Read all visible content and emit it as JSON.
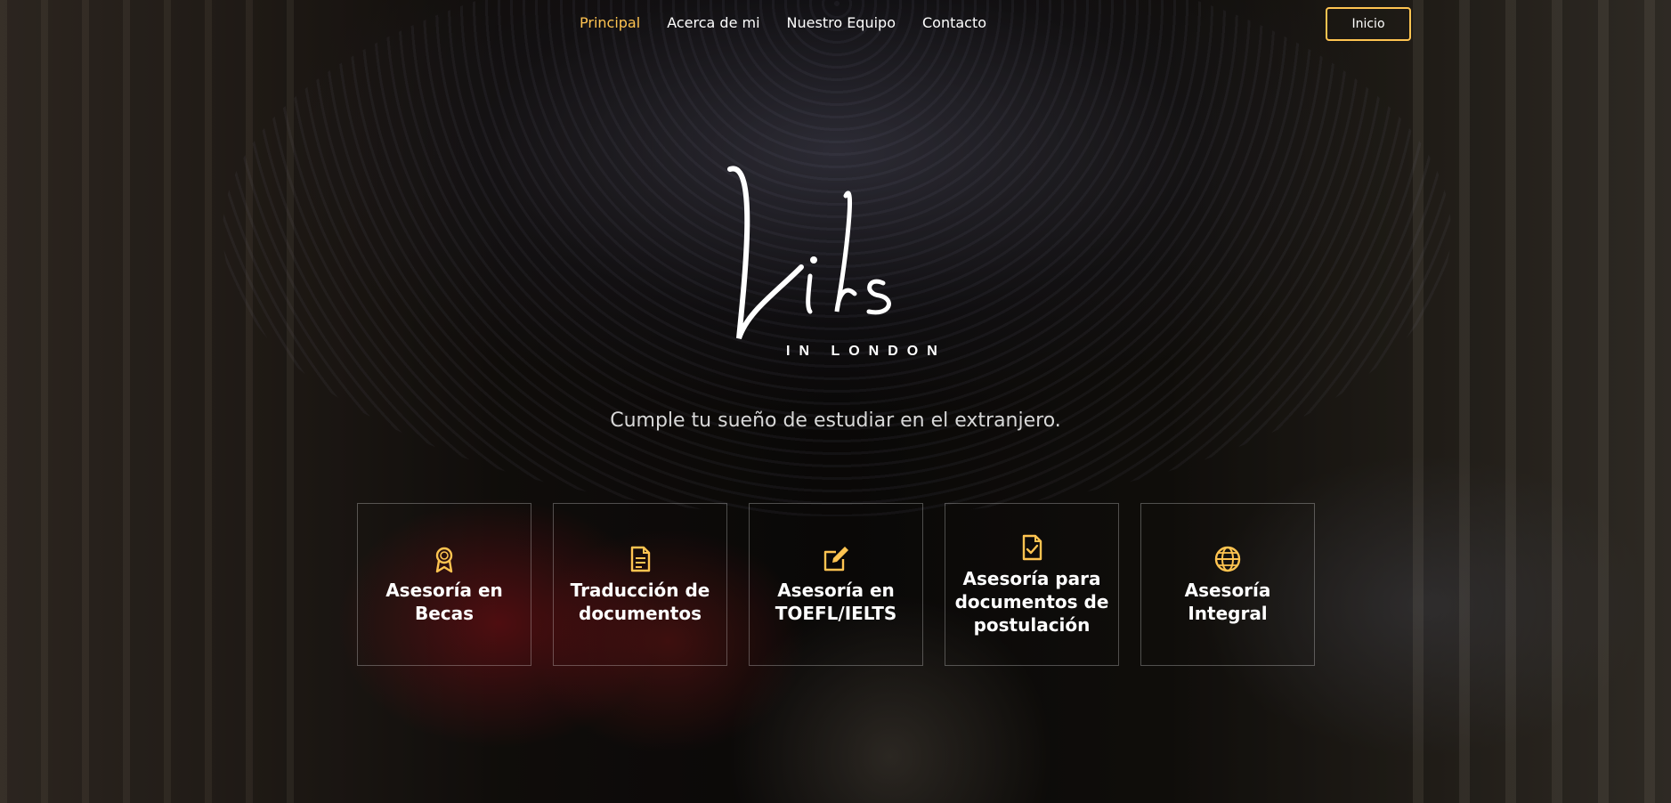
{
  "nav": {
    "links": [
      {
        "label": "Principal",
        "active": true
      },
      {
        "label": "Acerca de mi",
        "active": false
      },
      {
        "label": "Nuestro Equipo",
        "active": false
      },
      {
        "label": "Contacto",
        "active": false
      }
    ],
    "cta_label": "Inicio"
  },
  "brand": {
    "logo_script": "Lils",
    "logo_sub": "IN LONDON"
  },
  "hero": {
    "tagline": "Cumple tu sueño de estudiar en el extranjero."
  },
  "services": [
    {
      "title": "Asesoría en Becas",
      "icon": "award-icon"
    },
    {
      "title": "Traducción de documentos",
      "icon": "document-icon"
    },
    {
      "title": "Asesoría en TOEFL/IELTS",
      "icon": "edit-icon"
    },
    {
      "title": "Asesoría para documentos de postulación",
      "icon": "file-check-icon"
    },
    {
      "title": "Asesoría Integral",
      "icon": "globe-icon"
    }
  ],
  "colors": {
    "accent": "#ffc451",
    "text": "#ffffff",
    "tagline": "#d8d8d8"
  }
}
